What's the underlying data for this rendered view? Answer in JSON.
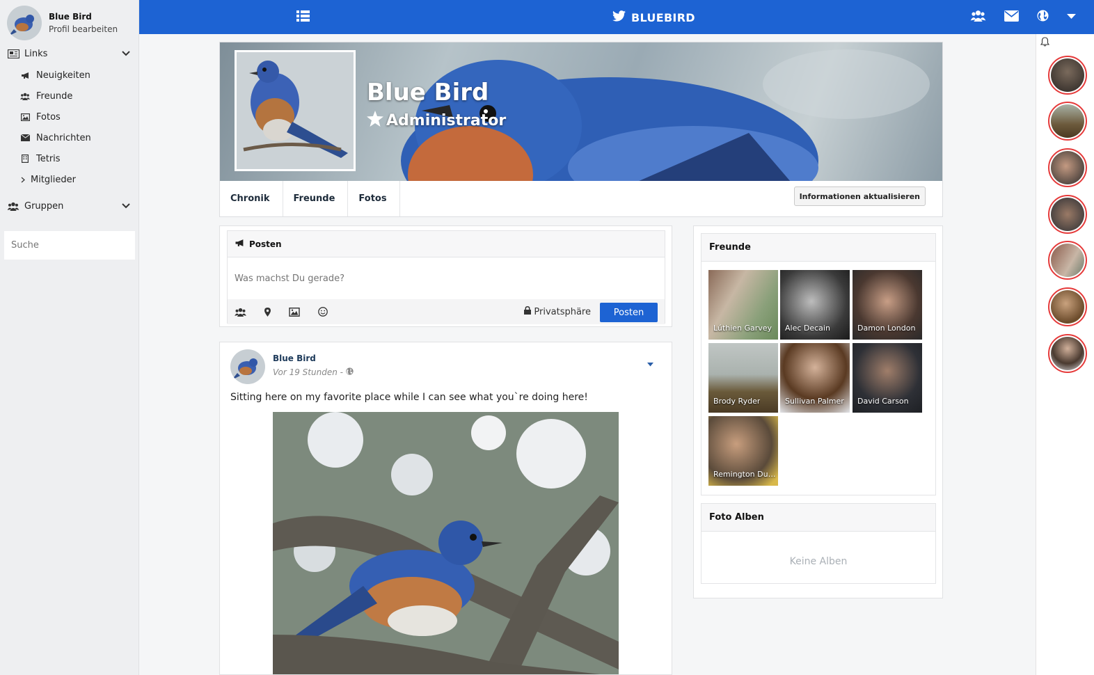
{
  "sidebar": {
    "user_name": "Blue Bird",
    "edit_profile": "Profil bearbeiten",
    "links_label": "Links",
    "items": [
      {
        "label": "Neuigkeiten",
        "icon": "megaphone-icon"
      },
      {
        "label": "Freunde",
        "icon": "users-icon"
      },
      {
        "label": "Fotos",
        "icon": "image-icon"
      },
      {
        "label": "Nachrichten",
        "icon": "envelope-icon"
      },
      {
        "label": "Tetris",
        "icon": "building-icon"
      },
      {
        "label": "Mitglieder",
        "icon": "chevron-right-icon"
      }
    ],
    "groups_label": "Gruppen",
    "search_placeholder": "Suche"
  },
  "topbar": {
    "brand": "BLUEBIRD",
    "accent": "#1d63d3"
  },
  "profile": {
    "name": "Blue Bird",
    "role": "Administrator",
    "tabs": [
      "Chronik",
      "Freunde",
      "Fotos"
    ],
    "update_button": "Informationen aktualisieren"
  },
  "composer": {
    "title": "Posten",
    "placeholder": "Was machst Du gerade?",
    "privacy": "Privatsphäre",
    "submit": "Posten"
  },
  "post": {
    "author": "Blue Bird",
    "time": "Vor 19 Stunden -",
    "text": "Sitting here on my favorite place while I can see what you`re doing here!"
  },
  "friends_panel": {
    "title": "Freunde",
    "friends": [
      {
        "name": "Lúthien Garvey"
      },
      {
        "name": "Alec Decain"
      },
      {
        "name": "Damon London"
      },
      {
        "name": "Brody Ryder"
      },
      {
        "name": "Sullivan Palmer"
      },
      {
        "name": "David Carson"
      },
      {
        "name": "Remington Dun..."
      }
    ]
  },
  "albums_panel": {
    "title": "Foto Alben",
    "empty": "Keine Alben"
  },
  "colors": {
    "online_ring": "#e53a3a"
  }
}
